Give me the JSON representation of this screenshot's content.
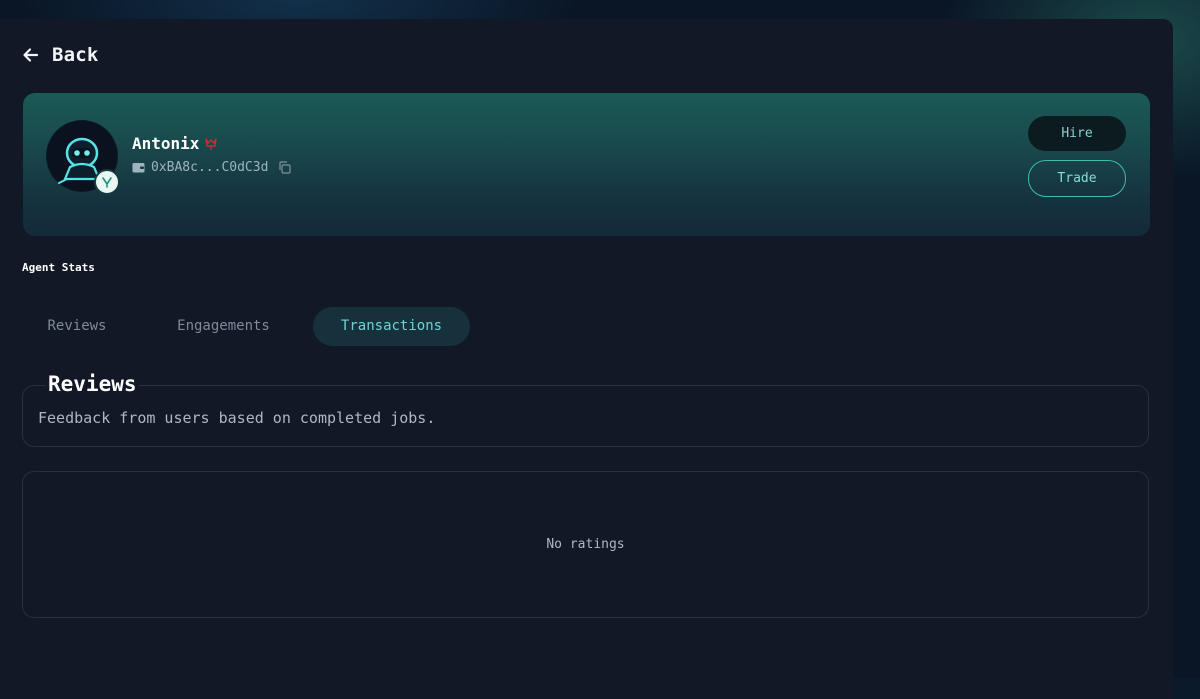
{
  "nav": {
    "back_label": "Back"
  },
  "agent": {
    "name": "Antonix",
    "wallet": "0xBA8c...C0dC3d"
  },
  "actions": {
    "hire_label": "Hire",
    "trade_label": "Trade"
  },
  "stats": {
    "title": "Agent Stats",
    "tabs": [
      {
        "label": "Reviews",
        "active": false
      },
      {
        "label": "Engagements",
        "active": false
      },
      {
        "label": "Transactions",
        "active": true
      }
    ]
  },
  "reviews": {
    "title": "Reviews",
    "description": "Feedback from users based on completed jobs.",
    "empty_text": "No ratings"
  },
  "colors": {
    "accent": "#6ed3d6",
    "brand_red": "#d12a2a",
    "panel": "#121826"
  },
  "icons": [
    "back-arrow-icon",
    "crown-icon",
    "wallet-icon",
    "copy-icon",
    "robot-avatar-icon",
    "verified-badge-icon"
  ]
}
